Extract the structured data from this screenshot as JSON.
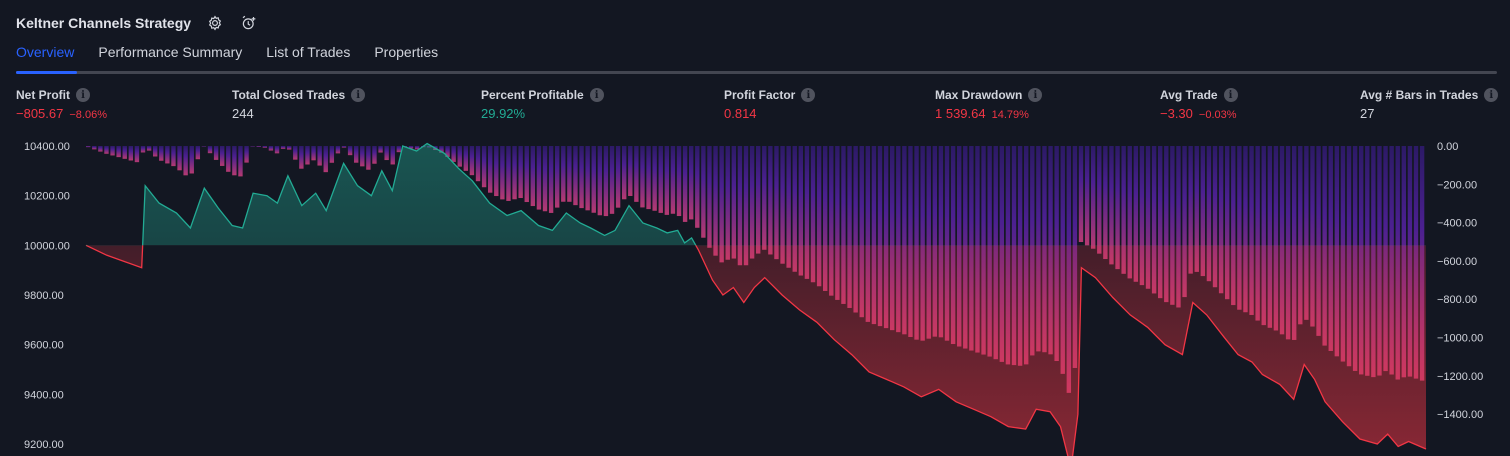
{
  "header": {
    "title": "Keltner Channels Strategy",
    "icons": [
      "gear-icon",
      "alarm-clock-plus-icon"
    ]
  },
  "tabs": [
    {
      "label": "Overview",
      "active": true
    },
    {
      "label": "Performance Summary",
      "active": false
    },
    {
      "label": "List of Trades",
      "active": false
    },
    {
      "label": "Properties",
      "active": false
    }
  ],
  "stats": {
    "net_profit": {
      "label": "Net Profit",
      "value": "−805.67",
      "pct": "−8.06%",
      "color": "#f23645"
    },
    "total_closed_trades": {
      "label": "Total Closed Trades",
      "value": "244"
    },
    "percent_profitable": {
      "label": "Percent Profitable",
      "value": "29.92%",
      "color": "#22ab94"
    },
    "profit_factor": {
      "label": "Profit Factor",
      "value": "0.814",
      "color": "#f23645"
    },
    "max_drawdown": {
      "label": "Max Drawdown",
      "value": "1 539.64",
      "pct": "14.79%",
      "color": "#f23645"
    },
    "avg_trade": {
      "label": "Avg Trade",
      "value": "−3.30",
      "pct": "−0.03%",
      "color": "#f23645"
    },
    "avg_bars": {
      "label": "Avg # Bars in Trades",
      "value": "27"
    }
  },
  "chart_data": [
    {
      "type": "line",
      "name": "equity",
      "baseline": 10000,
      "ylim": [
        9200,
        10400
      ],
      "y_ticks": [
        "10400.00",
        "10200.00",
        "10000.00",
        "9800.00",
        "9600.00",
        "9400.00",
        "9200.00"
      ],
      "colors": {
        "above": "#22ab94",
        "below": "#f23645"
      },
      "points": [
        [
          0,
          10000
        ],
        [
          6,
          9960
        ],
        [
          10,
          9940
        ],
        [
          16,
          9910
        ],
        [
          17,
          10240
        ],
        [
          21,
          10170
        ],
        [
          26,
          10130
        ],
        [
          30,
          10070
        ],
        [
          34,
          10230
        ],
        [
          38,
          10150
        ],
        [
          42,
          10080
        ],
        [
          45,
          10070
        ],
        [
          48,
          10210
        ],
        [
          52,
          10200
        ],
        [
          55,
          10170
        ],
        [
          58,
          10280
        ],
        [
          62,
          10160
        ],
        [
          66,
          10210
        ],
        [
          69,
          10140
        ],
        [
          74,
          10330
        ],
        [
          78,
          10240
        ],
        [
          82,
          10200
        ],
        [
          85,
          10300
        ],
        [
          88,
          10220
        ],
        [
          91,
          10400
        ],
        [
          95,
          10380
        ],
        [
          98,
          10410
        ],
        [
          103,
          10370
        ],
        [
          107,
          10310
        ],
        [
          111,
          10260
        ],
        [
          116,
          10170
        ],
        [
          121,
          10120
        ],
        [
          125,
          10140
        ],
        [
          130,
          10080
        ],
        [
          134,
          10060
        ],
        [
          138,
          10130
        ],
        [
          142,
          10090
        ],
        [
          145,
          10070
        ],
        [
          149,
          10040
        ],
        [
          152,
          10060
        ],
        [
          156,
          10160
        ],
        [
          160,
          10090
        ],
        [
          164,
          10070
        ],
        [
          167,
          10050
        ],
        [
          170,
          10060
        ],
        [
          172,
          10010
        ],
        [
          174,
          10030
        ],
        [
          176,
          9980
        ],
        [
          180,
          9860
        ],
        [
          183,
          9800
        ],
        [
          186,
          9830
        ],
        [
          189,
          9770
        ],
        [
          192,
          9830
        ],
        [
          195,
          9870
        ],
        [
          200,
          9800
        ],
        [
          205,
          9740
        ],
        [
          210,
          9690
        ],
        [
          215,
          9620
        ],
        [
          220,
          9560
        ],
        [
          225,
          9490
        ],
        [
          230,
          9460
        ],
        [
          235,
          9430
        ],
        [
          240,
          9390
        ],
        [
          245,
          9420
        ],
        [
          250,
          9370
        ],
        [
          255,
          9340
        ],
        [
          260,
          9310
        ],
        [
          265,
          9270
        ],
        [
          270,
          9260
        ],
        [
          273,
          9340
        ],
        [
          277,
          9330
        ],
        [
          280,
          9270
        ],
        [
          283,
          9100
        ],
        [
          285,
          9320
        ],
        [
          286,
          9910
        ],
        [
          290,
          9870
        ],
        [
          295,
          9790
        ],
        [
          300,
          9720
        ],
        [
          305,
          9670
        ],
        [
          310,
          9600
        ],
        [
          315,
          9560
        ],
        [
          318,
          9770
        ],
        [
          322,
          9720
        ],
        [
          327,
          9630
        ],
        [
          331,
          9560
        ],
        [
          335,
          9530
        ],
        [
          338,
          9480
        ],
        [
          343,
          9440
        ],
        [
          347,
          9380
        ],
        [
          350,
          9520
        ],
        [
          353,
          9460
        ],
        [
          356,
          9370
        ],
        [
          361,
          9290
        ],
        [
          366,
          9220
        ],
        [
          371,
          9200
        ],
        [
          374,
          9240
        ],
        [
          377,
          9190
        ],
        [
          380,
          9210
        ],
        [
          385,
          9180
        ]
      ]
    },
    {
      "type": "bar",
      "name": "drawdown",
      "ylim": [
        -1540,
        0
      ],
      "y_ticks": [
        "0.00",
        "−200.00",
        "−400.00",
        "−600.00",
        "−800.00",
        "−1000.00",
        "−1200.00",
        "−1400.00"
      ],
      "y_tick_values": [
        0,
        -200,
        -400,
        -600,
        -800,
        -1000,
        -1200,
        -1400
      ],
      "colors": {
        "top": "#3e1f8a",
        "bottom": "#bb3a6e"
      },
      "points": [
        [
          0,
          0
        ],
        [
          6,
          -40
        ],
        [
          10,
          -60
        ],
        [
          16,
          -90
        ],
        [
          17,
          0
        ],
        [
          21,
          -70
        ],
        [
          26,
          -110
        ],
        [
          30,
          -170
        ],
        [
          34,
          0
        ],
        [
          38,
          -80
        ],
        [
          42,
          -150
        ],
        [
          45,
          -160
        ],
        [
          48,
          0
        ],
        [
          52,
          -10
        ],
        [
          55,
          -40
        ],
        [
          58,
          0
        ],
        [
          62,
          -120
        ],
        [
          66,
          -70
        ],
        [
          69,
          -140
        ],
        [
          74,
          0
        ],
        [
          78,
          -90
        ],
        [
          82,
          -130
        ],
        [
          85,
          -30
        ],
        [
          88,
          -110
        ],
        [
          91,
          0
        ],
        [
          95,
          -20
        ],
        [
          98,
          0
        ],
        [
          103,
          -40
        ],
        [
          107,
          -100
        ],
        [
          111,
          -150
        ],
        [
          116,
          -240
        ],
        [
          121,
          -290
        ],
        [
          125,
          -270
        ],
        [
          130,
          -330
        ],
        [
          134,
          -350
        ],
        [
          138,
          -280
        ],
        [
          142,
          -320
        ],
        [
          145,
          -340
        ],
        [
          149,
          -370
        ],
        [
          152,
          -350
        ],
        [
          156,
          -250
        ],
        [
          160,
          -320
        ],
        [
          164,
          -340
        ],
        [
          167,
          -360
        ],
        [
          170,
          -350
        ],
        [
          172,
          -400
        ],
        [
          174,
          -380
        ],
        [
          176,
          -430
        ],
        [
          180,
          -550
        ],
        [
          183,
          -610
        ],
        [
          186,
          -580
        ],
        [
          189,
          -640
        ],
        [
          192,
          -580
        ],
        [
          195,
          -540
        ],
        [
          200,
          -610
        ],
        [
          205,
          -670
        ],
        [
          210,
          -720
        ],
        [
          215,
          -790
        ],
        [
          220,
          -850
        ],
        [
          225,
          -920
        ],
        [
          230,
          -950
        ],
        [
          235,
          -980
        ],
        [
          240,
          -1020
        ],
        [
          245,
          -990
        ],
        [
          250,
          -1040
        ],
        [
          255,
          -1070
        ],
        [
          260,
          -1100
        ],
        [
          265,
          -1140
        ],
        [
          270,
          -1150
        ],
        [
          273,
          -1070
        ],
        [
          277,
          -1080
        ],
        [
          280,
          -1140
        ],
        [
          283,
          -1310
        ],
        [
          285,
          -1090
        ],
        [
          286,
          -500
        ],
        [
          290,
          -540
        ],
        [
          295,
          -620
        ],
        [
          300,
          -690
        ],
        [
          305,
          -740
        ],
        [
          310,
          -810
        ],
        [
          315,
          -850
        ],
        [
          318,
          -640
        ],
        [
          322,
          -690
        ],
        [
          327,
          -780
        ],
        [
          331,
          -850
        ],
        [
          335,
          -880
        ],
        [
          338,
          -930
        ],
        [
          343,
          -970
        ],
        [
          347,
          -1030
        ],
        [
          350,
          -890
        ],
        [
          353,
          -950
        ],
        [
          356,
          -1040
        ],
        [
          361,
          -1120
        ],
        [
          366,
          -1190
        ],
        [
          371,
          -1210
        ],
        [
          374,
          -1170
        ],
        [
          377,
          -1220
        ],
        [
          380,
          -1200
        ],
        [
          385,
          -1230
        ]
      ]
    }
  ]
}
